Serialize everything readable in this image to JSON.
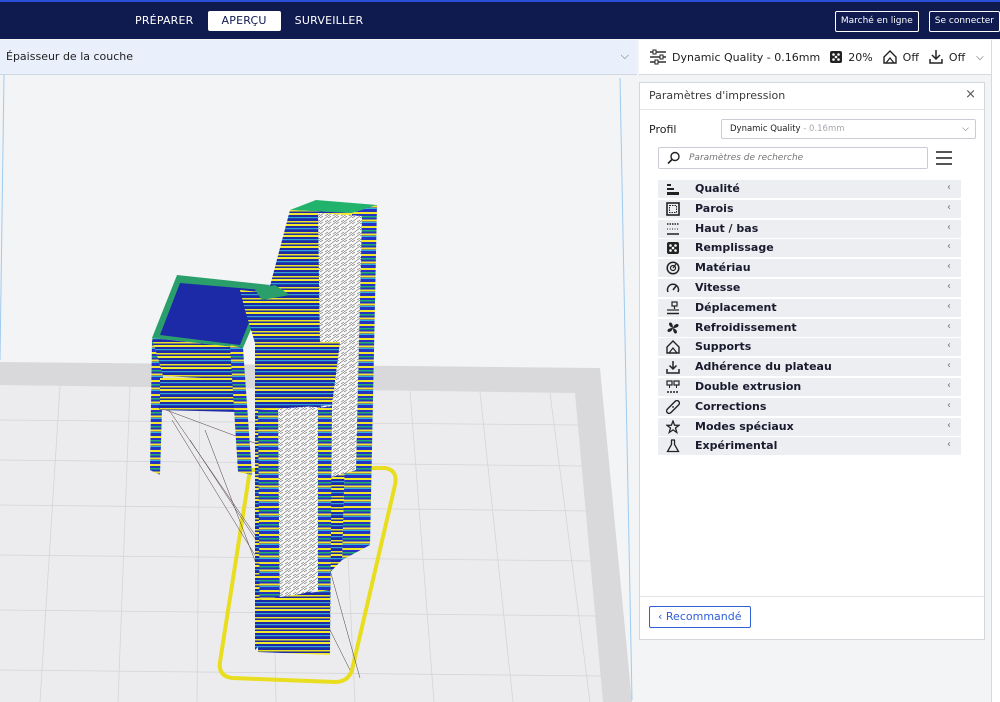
{
  "topbar": {
    "stages": [
      "PRÉPARER",
      "APERÇU",
      "SURVEILLER"
    ],
    "active_stage": "APERÇU",
    "marketplace_label": "Marché en ligne",
    "signin_label": "Se connecter"
  },
  "view_selector": {
    "label": "Épaisseur de la couche"
  },
  "print_setup": {
    "profile": "Dynamic Quality - 0.16mm",
    "infill": "20%",
    "support": "Off",
    "adhesion": "Off"
  },
  "settings_panel": {
    "title": "Paramètres d'impression",
    "profile_label": "Profil",
    "profile_value": "Dynamic Quality",
    "profile_suffix": " - 0.16mm",
    "search_placeholder": "Paramètres de recherche",
    "categories": [
      {
        "label": "Qualité",
        "icon": "quality-icon"
      },
      {
        "label": "Parois",
        "icon": "walls-icon"
      },
      {
        "label": "Haut / bas",
        "icon": "top-bottom-icon"
      },
      {
        "label": "Remplissage",
        "icon": "infill-icon"
      },
      {
        "label": "Matériau",
        "icon": "material-icon"
      },
      {
        "label": "Vitesse",
        "icon": "speed-icon"
      },
      {
        "label": "Déplacement",
        "icon": "travel-icon"
      },
      {
        "label": "Refroidissement",
        "icon": "cooling-fan-icon"
      },
      {
        "label": "Supports",
        "icon": "support-icon"
      },
      {
        "label": "Adhérence du plateau",
        "icon": "adhesion-icon"
      },
      {
        "label": "Double extrusion",
        "icon": "dual-extrusion-icon"
      },
      {
        "label": "Corrections",
        "icon": "fixes-icon"
      },
      {
        "label": "Modes spéciaux",
        "icon": "special-modes-icon"
      },
      {
        "label": "Expérimental",
        "icon": "experimental-icon"
      }
    ],
    "recommended_label": "Recommandé"
  },
  "colors": {
    "topbar_bg": "#0f1a4f",
    "accent": "#2f60d8",
    "layer_blue": "#1f2fb8",
    "layer_yellow": "#f0e62a",
    "layer_green": "#1fb06a"
  }
}
